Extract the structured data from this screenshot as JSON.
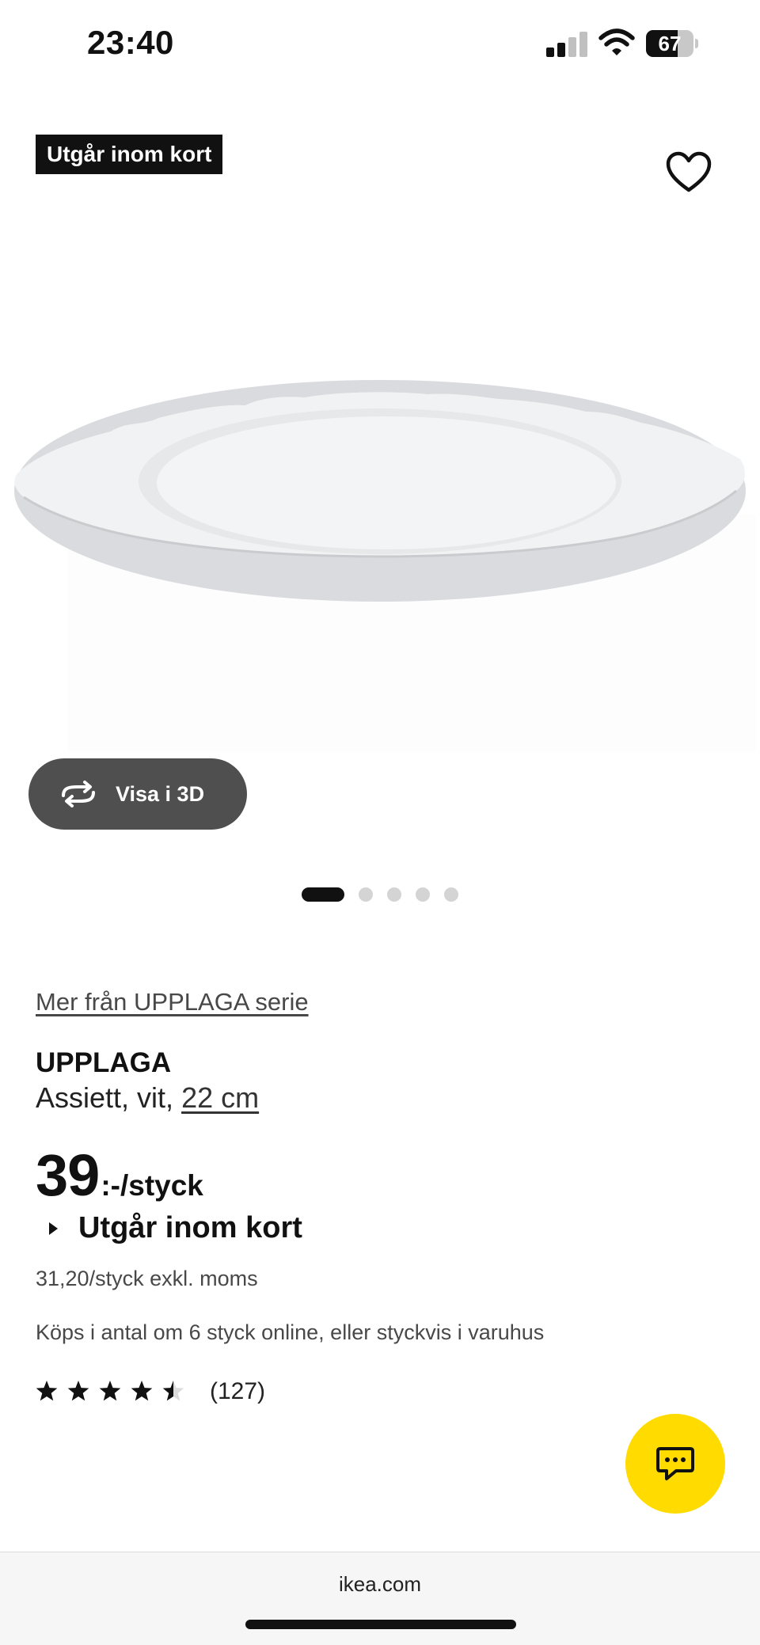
{
  "status_bar": {
    "time": "23:40",
    "battery_level": 67,
    "signal_bars_filled": 2,
    "signal_bars_total": 4
  },
  "product_image": {
    "badge": "Utgår inom kort",
    "view_3d_label": "Visa i 3D",
    "carousel": {
      "total": 5,
      "active_index": 0
    }
  },
  "product": {
    "series_link": "Mer från UPPLAGA serie",
    "name": "UPPLAGA",
    "description_prefix": "Assiett, vit,",
    "size": "22 cm",
    "price_main": "39",
    "price_unit": ":-/styck",
    "availability": "Utgår inom kort",
    "price_excl_vat": "31,20/styck exkl. moms",
    "purchase_note": "Köps i antal om 6 styck online, eller styckvis i varuhus",
    "rating": 4.5,
    "reviews_count": "(127)"
  },
  "browser": {
    "url": "ikea.com"
  },
  "colors": {
    "accent_yellow": "#ffdb00",
    "badge_bg": "#111111",
    "button_3d_bg": "#4f4f4f"
  },
  "icons": [
    "heart-icon",
    "rotate-3d-icon",
    "chat-icon",
    "star-icon"
  ]
}
